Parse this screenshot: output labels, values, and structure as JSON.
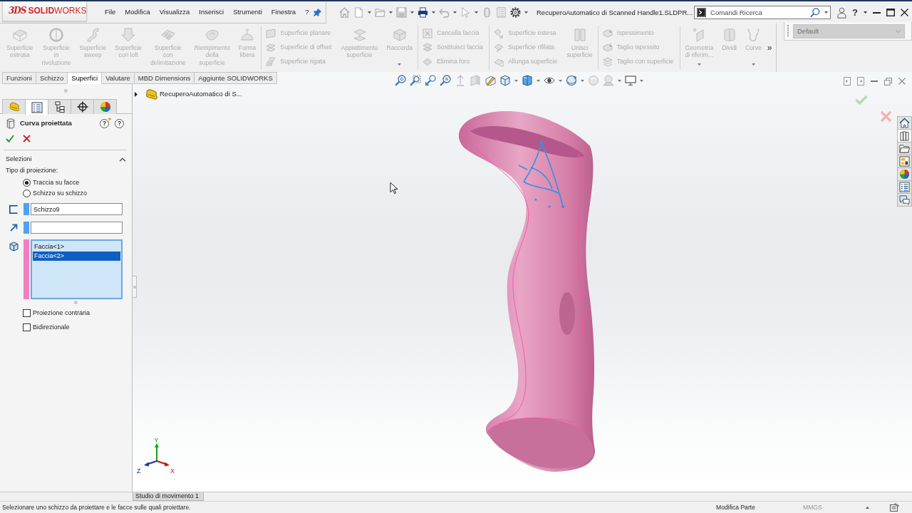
{
  "logo": {
    "mark": "3DS",
    "text": "**SOLID**WORKS"
  },
  "menu": [
    "File",
    "Modifica",
    "Visualizza",
    "Inserisci",
    "Strumenti",
    "Finestra",
    "?"
  ],
  "window": {
    "title": "RecuperoAutomatico di Scanned Handle1.SLDPR...",
    "help": "?"
  },
  "search": {
    "placeholder": "Comandi Ricerca"
  },
  "command_sections": [
    {
      "items": [
        {
          "kind": "large",
          "label": "Superficie\nestrusa",
          "disabled": true
        },
        {
          "kind": "large",
          "label": "Superficie\nin\nrivoluzione",
          "disabled": true
        },
        {
          "kind": "large",
          "label": "Superficie\nsweep",
          "disabled": true
        },
        {
          "kind": "large",
          "label": "Superficie\ncon loft",
          "disabled": true
        },
        {
          "kind": "large",
          "label": "Superficie\ncon\ndelimitazione",
          "disabled": true
        },
        {
          "kind": "large",
          "label": "Riempimento\ndella\nsuperficie",
          "disabled": true
        },
        {
          "kind": "large",
          "label": "Forma\nlibera",
          "disabled": true
        }
      ]
    },
    {
      "items": [
        {
          "kind": "small",
          "label": "Superficie planare",
          "disabled": true
        },
        {
          "kind": "small",
          "label": "Superficie di offset",
          "disabled": true
        },
        {
          "kind": "small",
          "label": "Superficie rigata",
          "disabled": true
        },
        {
          "kind": "large",
          "label": "Appiattimento\nsuperficie",
          "disabled": true
        },
        {
          "kind": "large",
          "label": "Raccorda",
          "disabled": true,
          "dropdown": true
        }
      ]
    },
    {
      "items": [
        {
          "kind": "small",
          "label": "Cancella faccia",
          "disabled": true
        },
        {
          "kind": "small",
          "label": "Sostituisci faccia",
          "disabled": true
        },
        {
          "kind": "small",
          "label": "Elimina foro",
          "disabled": true
        }
      ]
    },
    {
      "items": [
        {
          "kind": "small",
          "label": "Superficie estesa",
          "disabled": true
        },
        {
          "kind": "small",
          "label": "Superficie rifilata",
          "disabled": true
        },
        {
          "kind": "small",
          "label": "Allunga superficie",
          "disabled": true
        },
        {
          "kind": "large",
          "label": "Unisci\nsuperficie",
          "disabled": true
        }
      ]
    },
    {
      "items": [
        {
          "kind": "small",
          "label": "Ispessimento",
          "disabled": true
        },
        {
          "kind": "small",
          "label": "Taglio ispessito",
          "disabled": true
        },
        {
          "kind": "small",
          "label": "Taglio con superficie",
          "disabled": true
        }
      ]
    },
    {
      "items": [
        {
          "kind": "large",
          "label": "Geometria\ndi riferim...",
          "disabled": true,
          "dropdown": true
        },
        {
          "kind": "large",
          "label": "Dividi",
          "disabled": true
        },
        {
          "kind": "large",
          "label": "Curve",
          "disabled": true,
          "dropdown": true
        }
      ],
      "more": "»"
    }
  ],
  "configuration": {
    "value": "Default",
    "disabled": true
  },
  "tabs": [
    {
      "label": "Funzioni",
      "selected": false
    },
    {
      "label": "Schizzo",
      "selected": false
    },
    {
      "label": "Superfici",
      "selected": true
    },
    {
      "label": "Valutare",
      "selected": false
    },
    {
      "label": "MBD Dimensions",
      "selected": false
    },
    {
      "label": "Aggiunte SOLIDWORKS",
      "selected": false
    }
  ],
  "panel_tabs": [
    {
      "selected": false
    },
    {
      "selected": true
    },
    {
      "selected": false
    },
    {
      "selected": false
    },
    {
      "selected": false
    }
  ],
  "property_manager": {
    "title": "Curva proiettata",
    "help_buttons": [
      "?",
      "?"
    ],
    "section": {
      "title": "Selezioni",
      "expanded": true
    },
    "projection_label": "Tipo di proiezione:",
    "projection_options": [
      {
        "label": "Traccia su facce",
        "selected": true
      },
      {
        "label": "Schizzo su schizzo",
        "selected": false
      }
    ],
    "selection_boxes": [
      {
        "kind": "field",
        "value": "Schizzo9",
        "color": "#4da3f0"
      },
      {
        "kind": "field",
        "color": "#4da3f0"
      },
      {
        "kind": "list",
        "color": "#f07fc1",
        "items": [
          {
            "label": "Faccia<1>",
            "selected": false
          },
          {
            "label": "Faccia<2>",
            "selected": true
          }
        ]
      }
    ],
    "options": [
      {
        "label": "Proiezione contraria",
        "checked": false
      },
      {
        "label": "Bidirezionale",
        "checked": false
      }
    ]
  },
  "feature_tree": {
    "label": "RecuperoAutomatico di S...",
    "expanded": false
  },
  "task_pane": [
    {
      "selected": false
    },
    {
      "selected": true
    },
    {
      "selected": false
    },
    {
      "selected": false
    },
    {
      "selected": false
    },
    {
      "selected": false
    },
    {
      "selected": false
    }
  ],
  "triad": [
    "X",
    "Y",
    "Z"
  ],
  "motion_tabs": [
    {
      "label": "Studio di movimento 1",
      "selected": true
    }
  ],
  "status_bar": {
    "message": "Selezionare uno schizzo da proiettare e le facce sulle quali proiettare.",
    "mode": "Modifica Parte",
    "units": "MMGS"
  }
}
